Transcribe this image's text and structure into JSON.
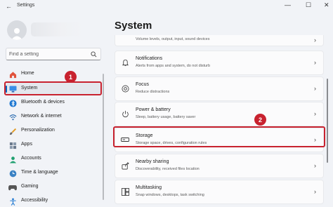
{
  "app": {
    "title": "Settings",
    "back_glyph": "←",
    "minimize_glyph": "—",
    "maximize_glyph": "☐",
    "close_glyph": "✕"
  },
  "search": {
    "placeholder": "Find a setting"
  },
  "sidebar": {
    "items": [
      {
        "label": "Home",
        "icon": "home-icon"
      },
      {
        "label": "System",
        "icon": "monitor-icon",
        "active": true
      },
      {
        "label": "Bluetooth & devices",
        "icon": "bluetooth-icon"
      },
      {
        "label": "Network & internet",
        "icon": "wifi-icon"
      },
      {
        "label": "Personalization",
        "icon": "brush-icon"
      },
      {
        "label": "Apps",
        "icon": "apps-icon"
      },
      {
        "label": "Accounts",
        "icon": "accounts-icon"
      },
      {
        "label": "Time & language",
        "icon": "globe-clock-icon"
      },
      {
        "label": "Gaming",
        "icon": "controller-icon"
      },
      {
        "label": "Accessibility",
        "icon": "accessibility-icon"
      }
    ]
  },
  "main": {
    "title": "System",
    "partial_subtitle": "Volume levels, output, input, sound devices",
    "cards": [
      {
        "title": "Notifications",
        "subtitle": "Alerts from apps and system, do not disturb",
        "icon": "bell-icon"
      },
      {
        "title": "Focus",
        "subtitle": "Reduce distractions",
        "icon": "focus-icon"
      },
      {
        "title": "Power & battery",
        "subtitle": "Sleep, battery usage, battery saver",
        "icon": "power-icon"
      },
      {
        "title": "Storage",
        "subtitle": "Storage space, drives, configuration rules",
        "icon": "storage-icon"
      },
      {
        "title": "Nearby sharing",
        "subtitle": "Discoverability, received files location",
        "icon": "share-icon"
      },
      {
        "title": "Multitasking",
        "subtitle": "Snap windows, desktops, task switching",
        "icon": "multitask-icon"
      }
    ],
    "chevron": "›"
  },
  "annotations": {
    "step1": "1",
    "step2": "2",
    "color": "#c8222f"
  }
}
